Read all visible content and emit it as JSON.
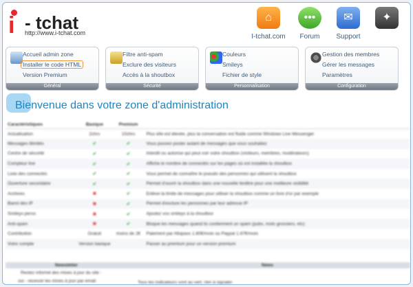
{
  "logo": {
    "letter": "i",
    "name": "- tchat",
    "url": "http://www.i-tchat.com"
  },
  "topnav": [
    {
      "label": "I-tchat.com",
      "icon": "home-icon",
      "color": "#f07a12"
    },
    {
      "label": "Forum",
      "icon": "chat-bubble-icon",
      "color": "#3da62a"
    },
    {
      "label": "Support",
      "icon": "support-icon",
      "color": "#2d6cd0"
    },
    {
      "label": "",
      "icon": "puzzle-icon",
      "color": "#333333"
    }
  ],
  "panels": [
    {
      "footer": "Général",
      "icon": "monitor-icon",
      "items": [
        "Accueil admin zone",
        "Installer le code HTML",
        "Version Premium"
      ]
    },
    {
      "footer": "Sécurité",
      "icon": "lock-icon",
      "items": [
        "Filtre anti-spam",
        "Exclure des visiteurs",
        "Accès à la shoutbox"
      ]
    },
    {
      "footer": "Personnalisation",
      "icon": "palette-icon",
      "items": [
        "Couleurs",
        "Smileys",
        "Fichier de style"
      ]
    },
    {
      "footer": "Configuration",
      "icon": "gears-icon",
      "items": [
        "Gestion des membres",
        "Gérer les messages",
        "Paramètres"
      ]
    }
  ],
  "title": "Bienvenue dans votre zone d'administration",
  "features": {
    "headers": [
      "Caractéristiques",
      "Basique",
      "Premium",
      ""
    ],
    "rows": [
      [
        "Actualisation",
        "2chrs",
        "10chrs",
        "Plus elle est élevée, plus la conversation est fluide comme Windows Live Messenger"
      ],
      [
        "Messages illimités",
        "ok",
        "ok",
        "Vous pouvez poster autant de messages que vous souhaitez"
      ],
      [
        "Centre de sécurité",
        "ok",
        "ok",
        "Interdit ou autorise qui peut voir votre shoutbox (visiteurs, membres, modérateurs)"
      ],
      [
        "Compteur live",
        "ok",
        "ok",
        "Affiche le nombre de connectés sur les pages où est installée la shoutbox"
      ],
      [
        "Liste des connectés",
        "ok",
        "ok",
        "Vous permet de connaître le pseudo des personnes qui utilisent la shoutbox"
      ],
      [
        "Ouverture secondaire",
        "ok",
        "ok",
        "Permet d'ouvrir la shoutbox dans une nouvelle fenêtre pour une meilleure visibilité"
      ],
      [
        "Archives",
        "no",
        "ok",
        "Enlève la limite de messages pour utiliser la shoutbox comme un livre d'or par exemple"
      ],
      [
        "Banni des IP",
        "no",
        "ok",
        "Permet d'exclure les personnes par leur adresse IP"
      ],
      [
        "Smileys perso",
        "no",
        "ok",
        "Ajoutez vos smileys à la shoutbox"
      ],
      [
        "Anti-spam",
        "no",
        "ok",
        "Bloque les messages quand ils contiennent un spam (pubs, mots grossiers, etc)"
      ],
      [
        "Contribution",
        "Gratuit",
        "moins de 2€",
        "Paiement par Allopass 1.80€/mois ou Paypal 1.67€/mois"
      ],
      [
        "Votre compte",
        "Version basique",
        "",
        "Passer au premium pour un version premium"
      ]
    ]
  },
  "bottom": {
    "left_header": "Newsletter",
    "right_header": "News",
    "left_line1": "Restez informé des mises à jour du site :",
    "left_line2": "oui - recevoir les mises à jour par email",
    "right_line1": "Tous les indicateurs sont au vert, rien à signaler."
  }
}
